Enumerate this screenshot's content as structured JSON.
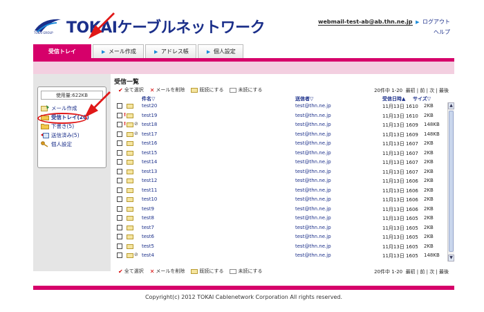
{
  "brand": {
    "logo_small": "TOKAI GROUP",
    "title": "TOKAIケーブルネットワーク"
  },
  "header": {
    "email": "webmail-test-ab@ab.thn.ne.jp",
    "logout": "ログアウト",
    "help": "ヘルプ"
  },
  "tabs": [
    {
      "label": "受信トレイ",
      "active": true
    },
    {
      "label": "メール作成"
    },
    {
      "label": "アドレス帳"
    },
    {
      "label": "個人設定"
    }
  ],
  "sidebar": {
    "usage": "使用量:622KB",
    "items": [
      {
        "label": "メール作成"
      },
      {
        "label": "受信トレイ(20)"
      },
      {
        "label": "下書き(5)"
      },
      {
        "label": "送信済み(5)"
      },
      {
        "label": "個人設定"
      }
    ]
  },
  "main": {
    "title": "受信一覧",
    "toolbar": {
      "select_all": "全て選択",
      "delete": "メールを削除",
      "mark_read": "既読にする",
      "mark_unread": "未読にする"
    },
    "pager": {
      "range": "20件中 1-20",
      "first": "最初",
      "prev": "前",
      "next": "次",
      "last": "最後"
    },
    "columns": {
      "subject": "件名▽",
      "from": "送信者▽",
      "date": "受信日時▲",
      "size": "サイズ▽"
    },
    "rows": [
      {
        "subject": "test20",
        "from": "test@thn.ne.jp",
        "date": "11月13日 1610",
        "size": "2KB",
        "flag": false,
        "clip": false
      },
      {
        "subject": "test19",
        "from": "test@thn.ne.jp",
        "date": "11月13日 1610",
        "size": "2KB",
        "flag": true,
        "clip": false
      },
      {
        "subject": "test18",
        "from": "test@thn.ne.jp",
        "date": "11月13日 1609",
        "size": "148KB",
        "flag": true,
        "clip": true
      },
      {
        "subject": "test17",
        "from": "test@thn.ne.jp",
        "date": "11月13日 1609",
        "size": "148KB",
        "flag": false,
        "clip": true
      },
      {
        "subject": "test16",
        "from": "test@thn.ne.jp",
        "date": "11月13日 1607",
        "size": "2KB",
        "flag": false,
        "clip": false
      },
      {
        "subject": "test15",
        "from": "test@thn.ne.jp",
        "date": "11月13日 1607",
        "size": "2KB",
        "flag": false,
        "clip": false
      },
      {
        "subject": "test14",
        "from": "test@thn.ne.jp",
        "date": "11月13日 1607",
        "size": "2KB",
        "flag": false,
        "clip": false
      },
      {
        "subject": "test13",
        "from": "test@thn.ne.jp",
        "date": "11月13日 1607",
        "size": "2KB",
        "flag": false,
        "clip": false
      },
      {
        "subject": "test12",
        "from": "test@thn.ne.jp",
        "date": "11月13日 1606",
        "size": "2KB",
        "flag": false,
        "clip": false
      },
      {
        "subject": "test11",
        "from": "test@thn.ne.jp",
        "date": "11月13日 1606",
        "size": "2KB",
        "flag": false,
        "clip": false
      },
      {
        "subject": "test10",
        "from": "test@thn.ne.jp",
        "date": "11月13日 1606",
        "size": "2KB",
        "flag": false,
        "clip": false
      },
      {
        "subject": "test9",
        "from": "test@thn.ne.jp",
        "date": "11月13日 1606",
        "size": "2KB",
        "flag": false,
        "clip": false
      },
      {
        "subject": "test8",
        "from": "test@thn.ne.jp",
        "date": "11月13日 1605",
        "size": "2KB",
        "flag": false,
        "clip": false
      },
      {
        "subject": "test7",
        "from": "test@thn.ne.jp",
        "date": "11月13日 1605",
        "size": "2KB",
        "flag": false,
        "clip": false
      },
      {
        "subject": "test6",
        "from": "test@thn.ne.jp",
        "date": "11月13日 1605",
        "size": "2KB",
        "flag": false,
        "clip": false
      },
      {
        "subject": "test5",
        "from": "test@thn.ne.jp",
        "date": "11月13日 1605",
        "size": "2KB",
        "flag": false,
        "clip": false
      },
      {
        "subject": "test4",
        "from": "test@thn.ne.jp",
        "date": "11月13日 1605",
        "size": "148KB",
        "flag": false,
        "clip": true
      }
    ]
  },
  "footer": {
    "copyright": "Copyright(c) 2012 TOKAI Cablenetwork Corporation All rights reserved."
  },
  "colors": {
    "brand_pink": "#d6006a",
    "brand_navy": "#1b2f8a",
    "annotation_red": "#e01818"
  }
}
